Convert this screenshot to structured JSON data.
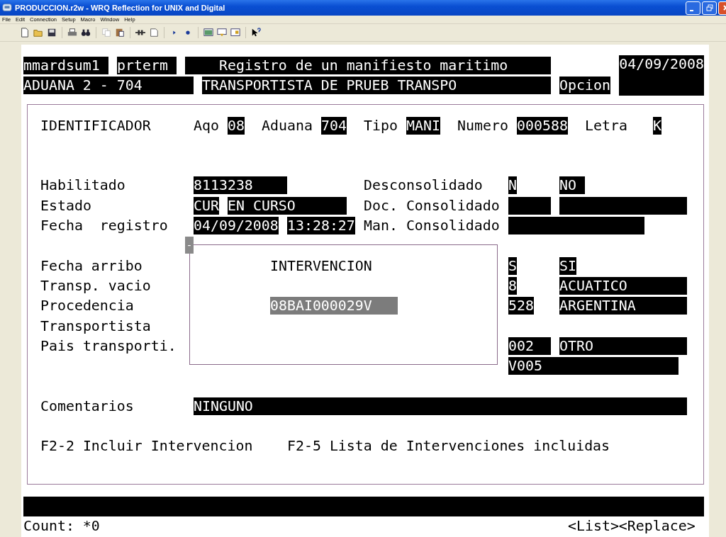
{
  "window": {
    "title": "PRODUCCION.r2w - WRQ Reflection for UNIX and Digital"
  },
  "menu": [
    "File",
    "Edit",
    "Connection",
    "Setup",
    "Macro",
    "Window",
    "Help"
  ],
  "header": {
    "user": "mmardsum1",
    "terminal": "prterm",
    "title": "Registro de un manifiesto maritimo",
    "date": "04/09/2008",
    "office": "ADUANA 2 - 704",
    "carrier": "TRANSPORTISTA DE PRUEB TRANSPO",
    "option": "Opcion"
  },
  "identifier": {
    "label": "IDENTIFICADOR",
    "parts": [
      {
        "label": "Aqo",
        "value": "08"
      },
      {
        "label": "Aduana",
        "value": "704"
      },
      {
        "label": "Tipo",
        "value": "MANI"
      },
      {
        "label": "Numero",
        "value": "000588"
      },
      {
        "label": "Letra",
        "value": "K"
      }
    ]
  },
  "fields_left": [
    {
      "label": "Habilitado",
      "values": [
        "8113238"
      ]
    },
    {
      "label": "Estado",
      "values": [
        "CUR",
        "EN CURSO"
      ]
    },
    {
      "label": "Fecha  registro",
      "values": [
        "04/09/2008",
        "13:28:27"
      ]
    },
    {
      "label": "Fecha arribo"
    },
    {
      "label": "Transp. vacio"
    },
    {
      "label": "Procedencia"
    },
    {
      "label": "Transportista"
    },
    {
      "label": "Pais transporti."
    }
  ],
  "fields_right": [
    {
      "label": "Desconsolidado",
      "values": [
        "N",
        "NO"
      ]
    },
    {
      "label": "Doc. Consolidado"
    },
    {
      "label": "Man. Consolidado"
    }
  ],
  "right_values": [
    [
      "S",
      "SI"
    ],
    [
      "8",
      "ACUATICO"
    ],
    [
      "528",
      "ARGENTINA"
    ],
    [
      "002",
      "OTRO"
    ],
    [
      "V005"
    ]
  ],
  "popup": {
    "handle": "-",
    "title": "INTERVENCION",
    "value": "08BAI000029V"
  },
  "comments": {
    "label": "Comentarios",
    "value": "NINGUNO"
  },
  "function_keys": [
    "F2-2 Incluir Intervencion",
    "F2-5 Lista de Intervenciones incluidas"
  ],
  "status": {
    "count": "Count: *0",
    "mode": "<List><Replace>"
  }
}
